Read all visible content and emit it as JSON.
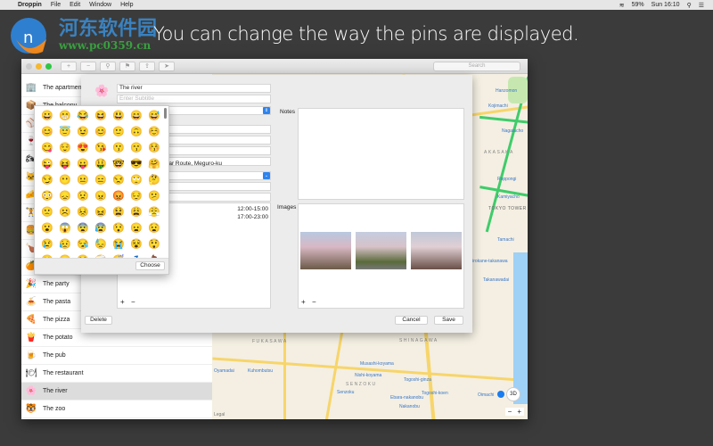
{
  "menubar": {
    "app": "Droppin",
    "items": [
      "File",
      "Edit",
      "Window",
      "Help"
    ],
    "battery": "59%",
    "clock": "Sun 16:10"
  },
  "watermark": {
    "site_name": "河东软件园",
    "url": "www.pc0359.cn"
  },
  "caption": "You can change the way the pins are displayed.",
  "toolbar": {
    "search_placeholder": "Search",
    "buttons": [
      "+",
      "−",
      "⚲",
      "⚑",
      "⇪",
      "➤"
    ]
  },
  "sidebar": {
    "items": [
      {
        "icon": "🏢",
        "label": "The apartment"
      },
      {
        "icon": "📦",
        "label": "The balcony"
      },
      {
        "icon": "⚾",
        "label": ""
      },
      {
        "icon": "🍷",
        "label": ""
      },
      {
        "icon": "🏍",
        "label": ""
      },
      {
        "icon": "🐱",
        "label": ""
      },
      {
        "icon": "🧀",
        "label": ""
      },
      {
        "icon": "🏋",
        "label": ""
      },
      {
        "icon": "🍔",
        "label": ""
      },
      {
        "icon": "🍗",
        "label": ""
      },
      {
        "icon": "🍊",
        "label": ""
      },
      {
        "icon": "🎉",
        "label": "The party"
      },
      {
        "icon": "🍝",
        "label": "The pasta"
      },
      {
        "icon": "🍕",
        "label": "The pizza"
      },
      {
        "icon": "🍟",
        "label": "The potato"
      },
      {
        "icon": "🍺",
        "label": "The pub"
      },
      {
        "icon": "🍽",
        "label": "The restaurant"
      },
      {
        "icon": "🌸",
        "label": "The river",
        "selected": true
      },
      {
        "icon": "🐯",
        "label": "The zoo"
      }
    ]
  },
  "sheet": {
    "emoji": "🌸",
    "title": "The river",
    "subtitle_placeholder": "Enter Subtitle",
    "address": "away Central Circular Route, Meguro-ku",
    "hours": [
      "12:00-15:00",
      "17:00-23:00"
    ],
    "notes_label": "Notes",
    "images_label": "Images",
    "add": "+",
    "remove": "−",
    "delete": "Delete",
    "cancel": "Cancel",
    "save": "Save"
  },
  "picker": {
    "choose": "Choose",
    "emojis": [
      "😀",
      "😁",
      "😂",
      "😆",
      "😃",
      "😄",
      "😅",
      "😊",
      "😇",
      "😉",
      "😊",
      "🙂",
      "🙃",
      "☺️",
      "😋",
      "😌",
      "😍",
      "😘",
      "😗",
      "😙",
      "😚",
      "😜",
      "😝",
      "😛",
      "🤑",
      "🤓",
      "😎",
      "🤗",
      "😏",
      "😶",
      "😐",
      "😑",
      "😒",
      "🙄",
      "🤔",
      "😳",
      "😞",
      "😟",
      "😠",
      "😡",
      "😔",
      "😕",
      "🙁",
      "☹️",
      "😣",
      "😖",
      "😫",
      "😩",
      "😤",
      "😮",
      "😱",
      "😨",
      "😰",
      "😯",
      "😦",
      "😧",
      "😢",
      "😥",
      "😪",
      "😓",
      "😭",
      "😵",
      "😲",
      "🤐",
      "😷",
      "🤒",
      "🤕",
      "😴",
      "💤",
      "💩"
    ]
  },
  "map": {
    "labels": [
      "Hanzomon",
      "Kojimachi",
      "Nagatacho",
      "AKASAKA",
      "Roppongi",
      "Kamiyacho",
      "TOKYO TOWER",
      "Tamachi",
      "Shirokane-takanawa",
      "Takanawadai",
      "Shinagawa",
      "FUKASAWA",
      "SHINAGAWA",
      "SENZOKU",
      "Senzoku",
      "Togoshi-ginza",
      "Ebara-nakanobu",
      "Togoshi-koen",
      "Oimachi",
      "Nakanobu",
      "Musashi-koyama",
      "Nishi-koyama",
      "Oyamadai",
      "Kuhombutsu",
      "Legal"
    ],
    "button_3d": "3D",
    "zoom_out": "−",
    "zoom_in": "+"
  }
}
